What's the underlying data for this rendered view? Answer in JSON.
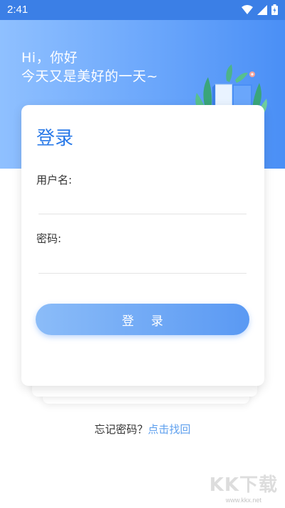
{
  "status_bar": {
    "time": "2:41"
  },
  "greeting": {
    "line1": "Hi，你好",
    "line2": "今天又是美好的一天~"
  },
  "login": {
    "title": "登录",
    "username_label": "用户名:",
    "password_label": "密码:",
    "button_label": "登录"
  },
  "footer": {
    "forgot_text": "忘记密码？",
    "find_link": "点击找回"
  },
  "watermark": {
    "logo": "KK下载",
    "url": "www.kkx.net"
  },
  "colors": {
    "accent": "#2a7ae8",
    "link": "#5fa0ee",
    "header_start": "#8fc0ff",
    "header_end": "#4a8ff6"
  }
}
